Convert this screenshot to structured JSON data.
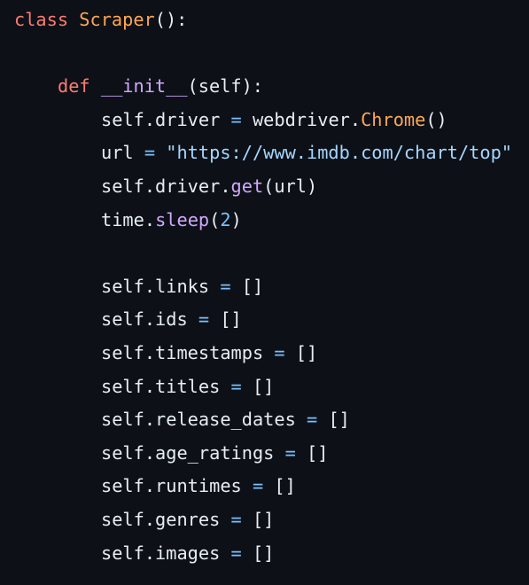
{
  "colors": {
    "background": "#0d1117",
    "text": "#e6edf3",
    "keyword": "#ff7b72",
    "class_name": "#ffa657",
    "function": "#d2a8ff",
    "string": "#a5d6ff",
    "number": "#79c0ff",
    "operator": "#79c0ff"
  },
  "code": {
    "line1": {
      "kw": "class",
      "name": "Scraper",
      "rest": "():"
    },
    "line3": {
      "kw": "def",
      "name": "__init__",
      "rest": "(self):"
    },
    "line4": {
      "a": "self.driver",
      "op": " = ",
      "b": "webdriver.",
      "call": "Chrome",
      "c": "()"
    },
    "line5": {
      "a": "url",
      "op": " = ",
      "str": "\"https://www.imdb.com/chart/top\""
    },
    "line6": {
      "a": "self.driver.",
      "call": "get",
      "c": "(url)"
    },
    "line7": {
      "a": "time.",
      "call": "sleep",
      "p1": "(",
      "num": "2",
      "p2": ")"
    },
    "attrs": [
      {
        "name": "self.links",
        "op": " = ",
        "val": "[]"
      },
      {
        "name": "self.ids",
        "op": " = ",
        "val": "[]"
      },
      {
        "name": "self.timestamps",
        "op": " = ",
        "val": "[]"
      },
      {
        "name": "self.titles",
        "op": " = ",
        "val": "[]"
      },
      {
        "name": "self.release_dates",
        "op": " = ",
        "val": "[]"
      },
      {
        "name": "self.age_ratings",
        "op": " = ",
        "val": "[]"
      },
      {
        "name": "self.runtimes",
        "op": " = ",
        "val": "[]"
      },
      {
        "name": "self.genres",
        "op": " = ",
        "val": "[]"
      },
      {
        "name": "self.images",
        "op": " = ",
        "val": "[]"
      }
    ]
  }
}
